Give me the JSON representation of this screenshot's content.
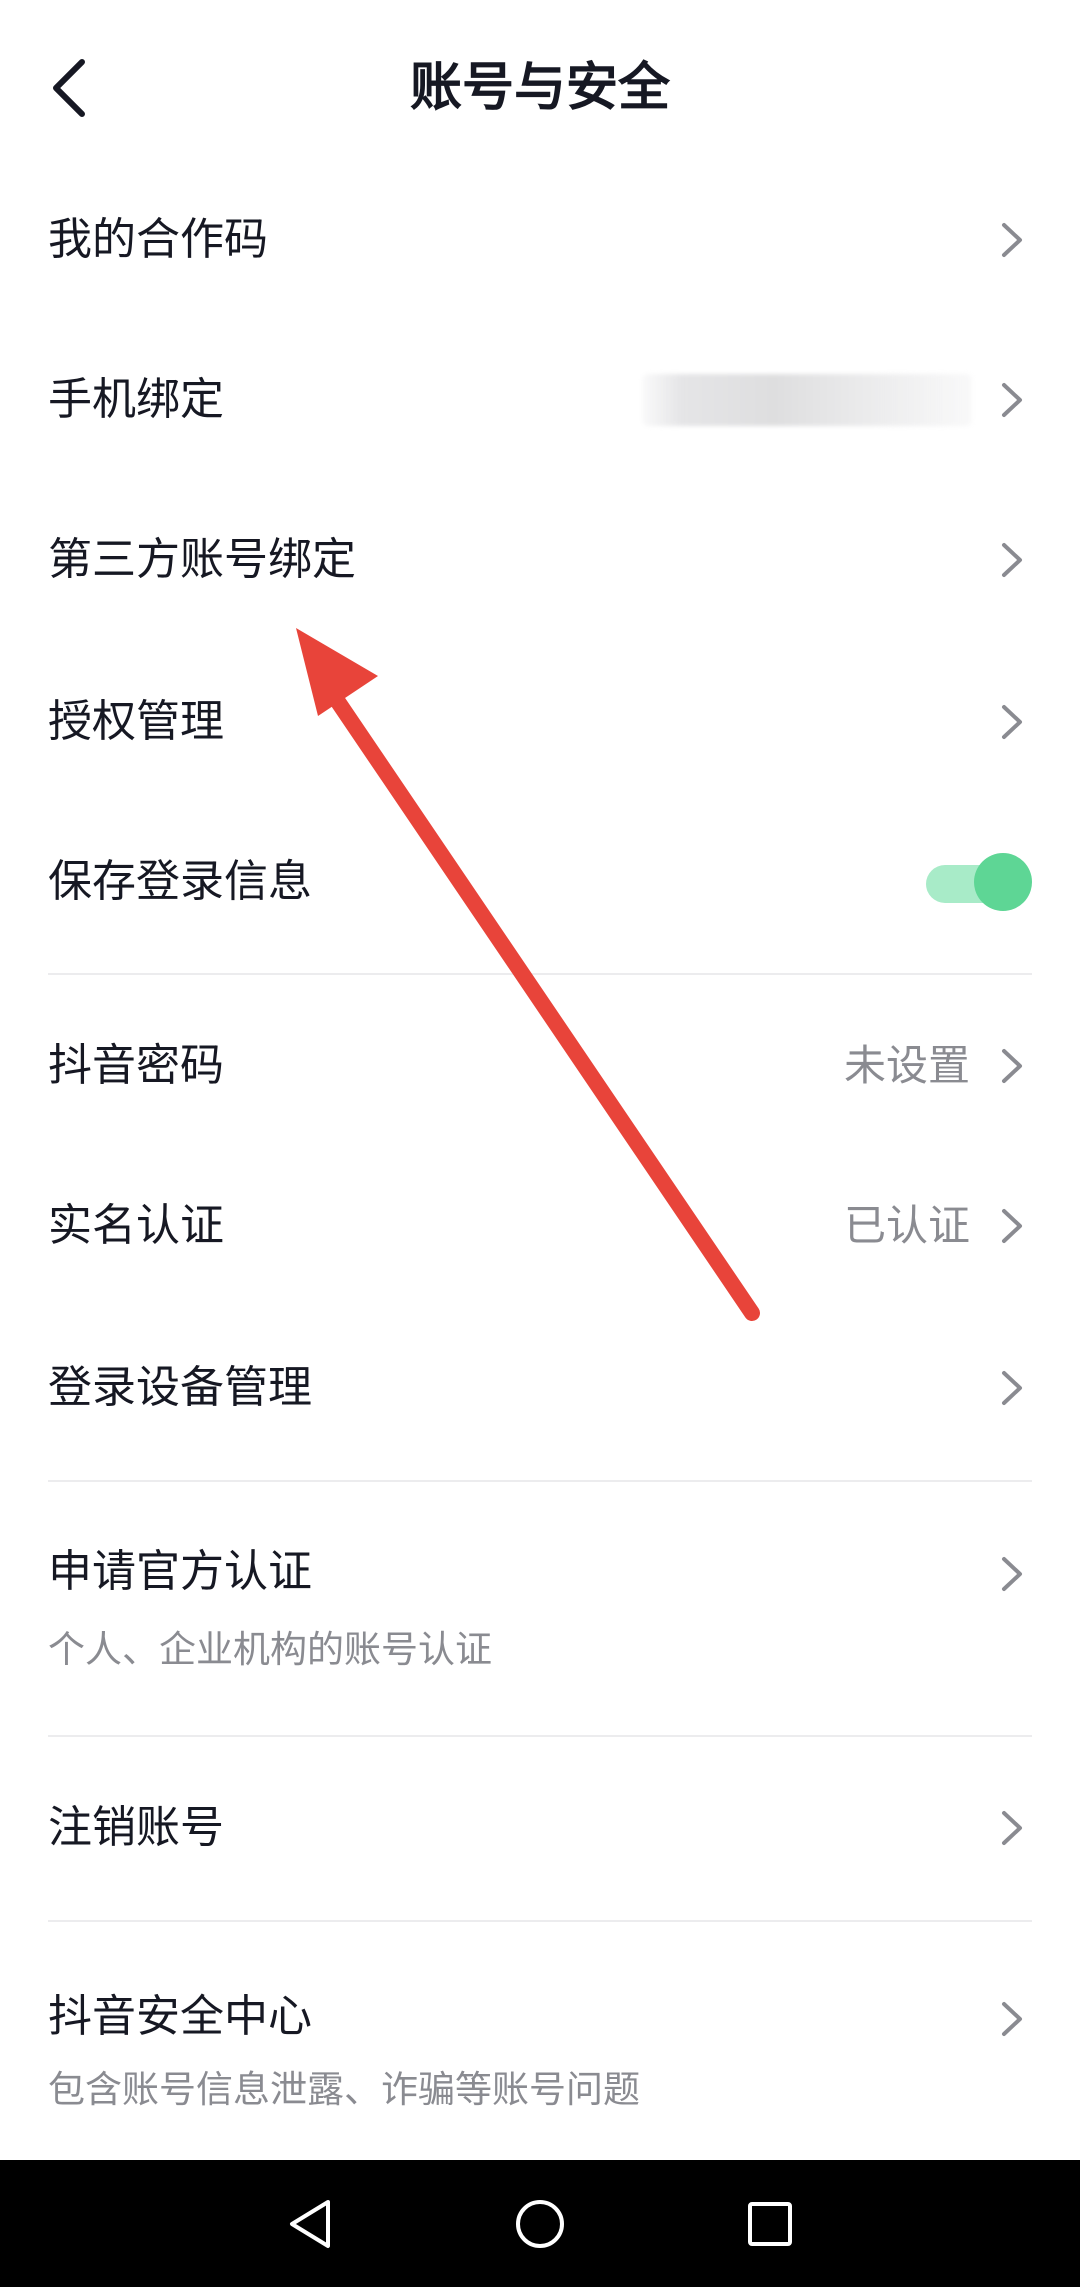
{
  "header": {
    "title": "账号与安全",
    "back_icon": "chevron-left-icon"
  },
  "items": [
    {
      "label": "我的合作码"
    },
    {
      "label": "手机绑定",
      "value_blurred": true
    },
    {
      "label": "第三方账号绑定"
    },
    {
      "label": "授权管理"
    },
    {
      "label": "保存登录信息",
      "toggle_on": true
    },
    {
      "label": "抖音密码",
      "value": "未设置"
    },
    {
      "label": "实名认证",
      "value": "已认证"
    },
    {
      "label": "登录设备管理"
    },
    {
      "label": "申请官方认证",
      "sub": "个人、企业机构的账号认证"
    },
    {
      "label": "注销账号"
    },
    {
      "label": "抖音安全中心",
      "sub": "包含账号信息泄露、诈骗等账号问题"
    }
  ],
  "colors": {
    "text_primary": "#161823",
    "text_secondary": "#8a8b91",
    "toggle_on": "#5ed695",
    "toggle_track": "#a8ebc8",
    "annotation_arrow": "#e8443a",
    "navbar": "#000000"
  },
  "navbar": {
    "back": "triangle-back-icon",
    "home": "circle-home-icon",
    "recents": "square-recents-icon"
  }
}
